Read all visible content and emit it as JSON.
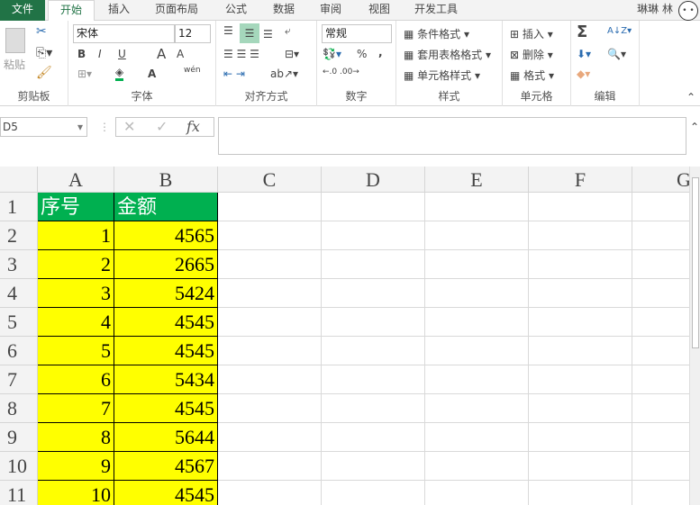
{
  "tabs": [
    "文件",
    "开始",
    "插入",
    "页面布局",
    "公式",
    "数据",
    "审阅",
    "视图",
    "开发工具"
  ],
  "user": "琳琳 林",
  "ribbon": {
    "clipboard": {
      "label": "剪贴板",
      "paste": "粘贴"
    },
    "font": {
      "label": "字体",
      "font_name": "宋体",
      "font_size": "12",
      "bold": "B",
      "italic": "I",
      "underline": "U",
      "grow": "A",
      "shrink": "A",
      "color": "A",
      "phonetic": "wén"
    },
    "alignment": {
      "label": "对齐方式"
    },
    "number": {
      "label": "数字",
      "format": "常规",
      "percent": "%",
      "comma": ","
    },
    "styles": {
      "label": "样式",
      "items": [
        "条件格式",
        "套用表格格式",
        "单元格样式"
      ]
    },
    "cells": {
      "label": "单元格",
      "items": [
        "插入",
        "删除",
        "格式"
      ]
    },
    "editing": {
      "label": "编辑",
      "sum": "Σ"
    }
  },
  "formula_bar": {
    "name_box": "D5",
    "fx": "fx",
    "value": ""
  },
  "columns": [
    "A",
    "B",
    "C",
    "D",
    "E",
    "F",
    "G"
  ],
  "rows": [
    "1",
    "2",
    "3",
    "4",
    "5",
    "6",
    "7",
    "8",
    "9",
    "10",
    "11"
  ],
  "table": {
    "headers": [
      "序号",
      "金额"
    ],
    "data": [
      [
        "1",
        "4565"
      ],
      [
        "2",
        "2665"
      ],
      [
        "3",
        "5424"
      ],
      [
        "4",
        "4545"
      ],
      [
        "5",
        "4545"
      ],
      [
        "6",
        "5434"
      ],
      [
        "7",
        "4545"
      ],
      [
        "8",
        "5644"
      ],
      [
        "9",
        "4567"
      ],
      [
        "10",
        "4545"
      ]
    ]
  },
  "colors": {
    "accent": "#217346",
    "header_fill": "#00b050",
    "data_fill": "#ffff00"
  }
}
